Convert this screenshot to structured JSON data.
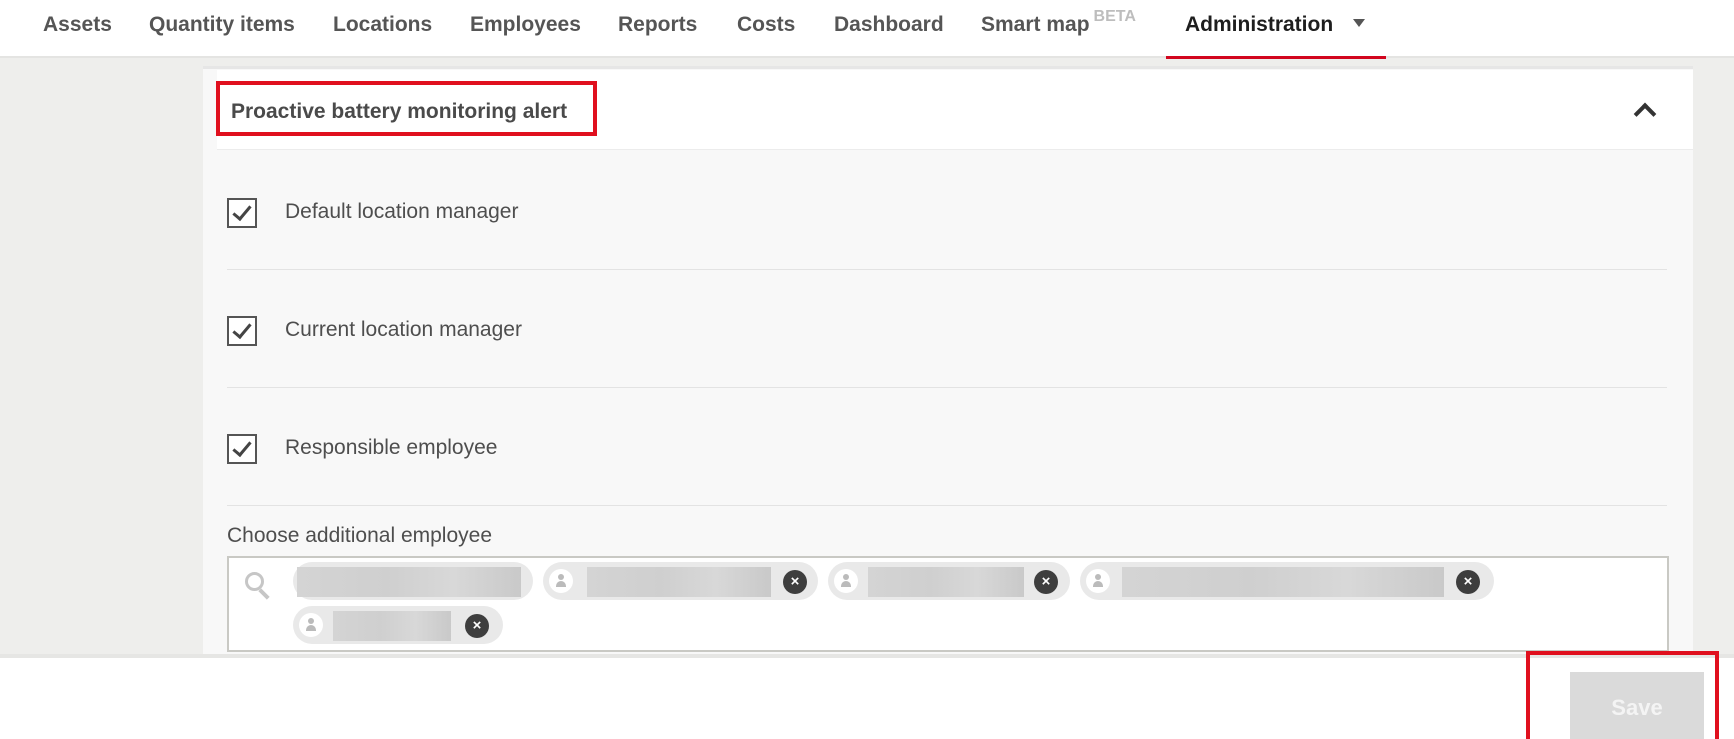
{
  "nav": {
    "items": [
      {
        "label": "Assets"
      },
      {
        "label": "Quantity items"
      },
      {
        "label": "Locations"
      },
      {
        "label": "Employees"
      },
      {
        "label": "Reports"
      },
      {
        "label": "Costs"
      },
      {
        "label": "Dashboard"
      },
      {
        "label": "Smart map",
        "badge": "BETA"
      },
      {
        "label": "Administration",
        "active": true
      }
    ]
  },
  "panel": {
    "title": "Proactive battery monitoring alert",
    "collapse_icon": "chevron-up-icon",
    "checkboxes": [
      {
        "label": "Default location manager",
        "checked": true
      },
      {
        "label": "Current location manager",
        "checked": true
      },
      {
        "label": "Responsible employee",
        "checked": true
      }
    ],
    "additional_employee": {
      "label": "Choose additional employee",
      "search_icon": "search-icon",
      "selected": [
        {
          "name": ""
        },
        {
          "name": ""
        },
        {
          "name": ""
        },
        {
          "name": ""
        },
        {
          "name": ""
        }
      ]
    }
  },
  "footer": {
    "save_label": "Save"
  },
  "colors": {
    "accent": "#d2051e",
    "highlight": "#e0101e",
    "save_disabled_bg": "#dadada"
  }
}
